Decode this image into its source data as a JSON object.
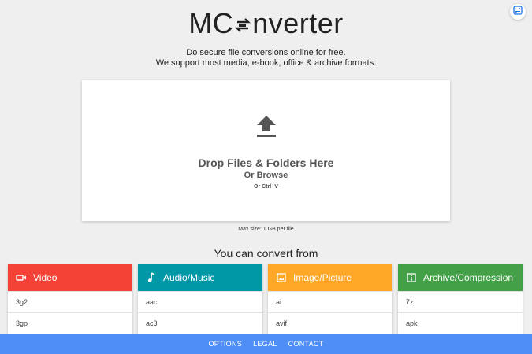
{
  "header": {
    "logo_left": "MC",
    "logo_right": "nverter",
    "logo_icon": "convert-arrows-icon",
    "corner_icon": "translate-icon"
  },
  "tagline": {
    "line1": "Do secure file conversions online for free.",
    "line2": "We support most media, e-book, office & archive formats."
  },
  "dropzone": {
    "icon": "upload-icon",
    "title": "Drop Files & Folders Here",
    "or_text": "Or",
    "browse": "Browse",
    "paste_hint": "Or Ctrl+V"
  },
  "max_size": "Max size: 1 GB per file",
  "convert_title": "You can convert from",
  "categories": [
    {
      "label": "Video",
      "color": "#f44336",
      "icon": "video-camera-icon",
      "items": [
        "3g2",
        "3gp"
      ]
    },
    {
      "label": "Audio/Music",
      "color": "#0097a7",
      "icon": "music-note-icon",
      "items": [
        "aac",
        "ac3"
      ]
    },
    {
      "label": "Image/Picture",
      "color": "#ffa726",
      "icon": "image-icon",
      "items": [
        "ai",
        "avif"
      ]
    },
    {
      "label": "Archive/Compression",
      "color": "#43a047",
      "icon": "archive-icon",
      "items": [
        "7z",
        "apk"
      ]
    }
  ],
  "footer": {
    "options": "OPTIONS",
    "legal": "LEGAL",
    "contact": "CONTACT",
    "bg_color": "#4e8ef5"
  }
}
